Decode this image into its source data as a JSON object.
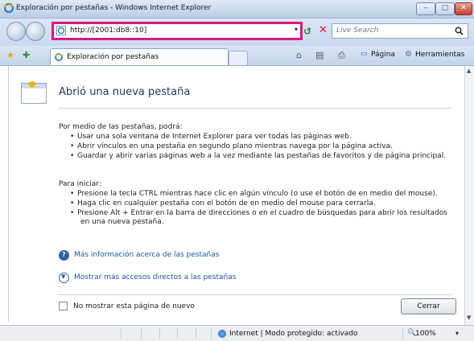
{
  "window": {
    "title": "Exploración por pestañas - Windows Internet Explorer",
    "minimize": "–",
    "maximize": "▢",
    "close": "✕"
  },
  "address": {
    "url": "http://[2001:db8::10]",
    "dropdown": "▾",
    "refresh": "↺",
    "stop": "✕"
  },
  "search": {
    "placeholder": "Live Search",
    "icon": "search-icon"
  },
  "tabs": [
    {
      "label": "Exploración por pestañas"
    }
  ],
  "toolbar": {
    "home": "⌂",
    "feeds": "▤",
    "print": "⎙",
    "page": "Página",
    "tools": "Herramientas"
  },
  "main": {
    "title": "Abrió una nueva pestaña",
    "intro": "Por medio de las pestañas, podrá:",
    "intro_bullets": [
      "Usar una sola ventana de Internet Explorer para ver todas las páginas web.",
      "Abrir vínculos en una pestaña en segundo plano mientras navega por la página activa.",
      "Guardar y abrir varias páginas web a la vez mediante las pestañas de favoritos y de página principal."
    ],
    "start": "Para iniciar:",
    "start_bullets": [
      "Presione la tecla CTRL mientras hace clic en algún vínculo (o use el botón de en medio del mouse).",
      "Haga clic en cualquier pestaña con el botón de en medio del mouse para cerrarla.",
      "Presione Alt + Entrar en la barra de direcciones o en el cuadro de búsquedas para abrir los resultados",
      "en una nueva pestaña."
    ],
    "link_more": "Más información acerca de las pestañas",
    "link_shortcuts": "Mostrar más accesos directos a las pestañas",
    "dont_show": "No mostrar esta página de nuevo",
    "close_button": "Cerrar"
  },
  "status": {
    "zone": "Internet | Modo protegido: activado",
    "zoom": "100%"
  }
}
